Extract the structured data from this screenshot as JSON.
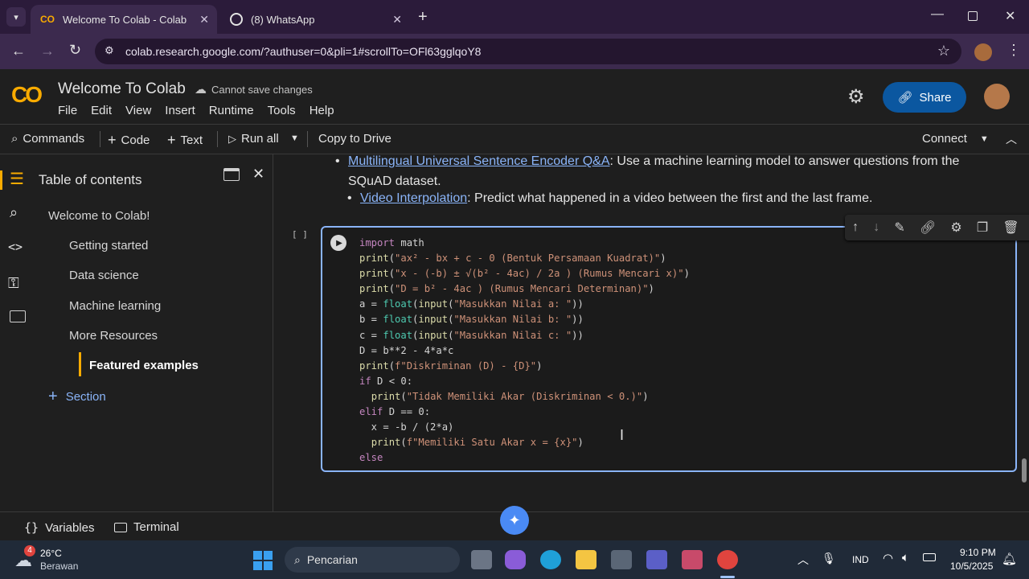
{
  "browser": {
    "tabs": [
      {
        "title": "Welcome To Colab - Colab",
        "active": true
      },
      {
        "title": "(8) WhatsApp",
        "active": false
      }
    ],
    "url": "colab.research.google.com/?authuser=0&pli=1#scrollTo=OFl63gglqoY8"
  },
  "colab": {
    "title": "Welcome To Colab",
    "save_status": "Cannot save changes",
    "menu": [
      "File",
      "Edit",
      "View",
      "Insert",
      "Runtime",
      "Tools",
      "Help"
    ],
    "share_label": "Share"
  },
  "toolbar": {
    "commands": "Commands",
    "code": "Code",
    "text": "Text",
    "run_all": "Run all",
    "copy_to_drive": "Copy to Drive",
    "connect": "Connect"
  },
  "toc": {
    "title": "Table of contents",
    "items": [
      {
        "label": "Welcome to Colab!",
        "level": 1
      },
      {
        "label": "Getting started",
        "level": 2
      },
      {
        "label": "Data science",
        "level": 2
      },
      {
        "label": "Machine learning",
        "level": 2
      },
      {
        "label": "More Resources",
        "level": 2
      },
      {
        "label": "Featured examples",
        "level": 3
      }
    ],
    "section_label": "Section"
  },
  "main": {
    "bullets": [
      {
        "link": "Multilingual Universal Sentence Encoder Q&A",
        "text": ": Use a machine learning model to answer questions from the",
        "text2": "SQuAD dataset."
      },
      {
        "link": "Video Interpolation",
        "text": ": Predict what happened in a video between the first and the last frame."
      }
    ],
    "cell_bracket": "[ ]",
    "code_lines": [
      "import math",
      "print(\"ax² - bx + c - 0 (Bentuk Persamaan Kuadrat)\")",
      "print(\"x - (-b) ± √(b² - 4ac) / 2a ) (Rumus Mencari x)\")",
      "print(\"D = b² - 4ac ) (Rumus Mencari Determinan)\")",
      "a = float(input(\"Masukkan Nilai a: \"))",
      "b = float(input(\"Masukkan Nilai b: \"))",
      "c = float(input(\"Masukkan Nilai c: \"))",
      "D = b**2 - 4*a*c",
      "print(f\"Diskriminan (D) - {D}\")",
      "if D < 0:",
      "  print(\"Tidak Memiliki Akar (Diskriminan < 0.)\")",
      "elif D == 0:",
      "  x = -b / (2*a)",
      "  print(f\"Memiliki Satu Akar x = {x}\")",
      "else"
    ]
  },
  "bottom": {
    "variables": "Variables",
    "terminal": "Terminal"
  },
  "taskbar": {
    "weather_temp": "26°C",
    "weather_desc": "Berawan",
    "weather_badge": "4",
    "search_placeholder": "Pencarian",
    "lang": "IND",
    "time": "9:10 PM",
    "date": "10/5/2025"
  },
  "colors": {
    "accent": "#8ab4f8",
    "share": "#0b57a0",
    "colab_orange": "#f9ab00"
  }
}
